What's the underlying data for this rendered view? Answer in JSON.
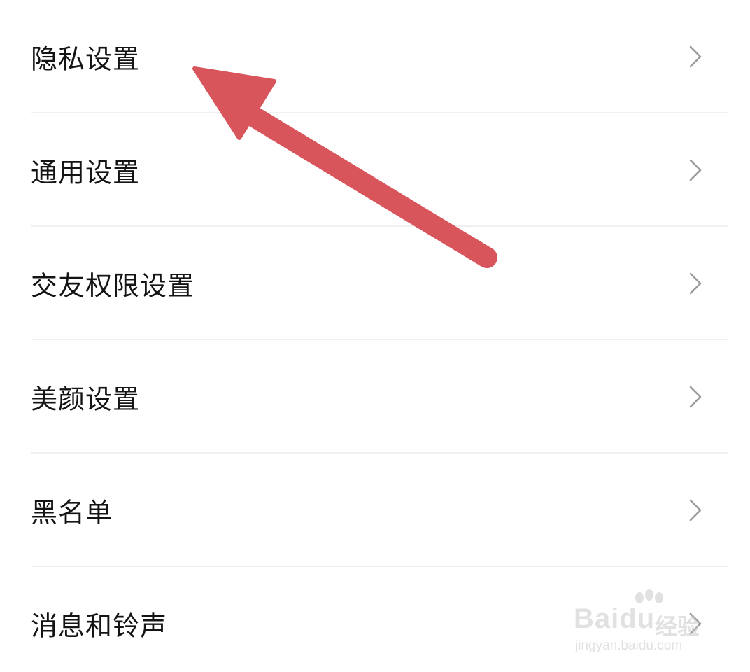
{
  "settings": {
    "items": [
      {
        "label": "隐私设置"
      },
      {
        "label": "通用设置"
      },
      {
        "label": "交友权限设置"
      },
      {
        "label": "美颜设置"
      },
      {
        "label": "黑名单"
      },
      {
        "label": "消息和铃声"
      }
    ]
  },
  "annotation": {
    "arrow_color": "#D9555C",
    "points_to": "隐私设置"
  },
  "watermark": {
    "brand": "Baidu",
    "brand_cn": "经验",
    "url": "jingyan.baidu.com"
  },
  "colors": {
    "text": "#141414",
    "chevron": "#9a9a9a",
    "divider": "#f0f0f0",
    "background": "#ffffff"
  }
}
